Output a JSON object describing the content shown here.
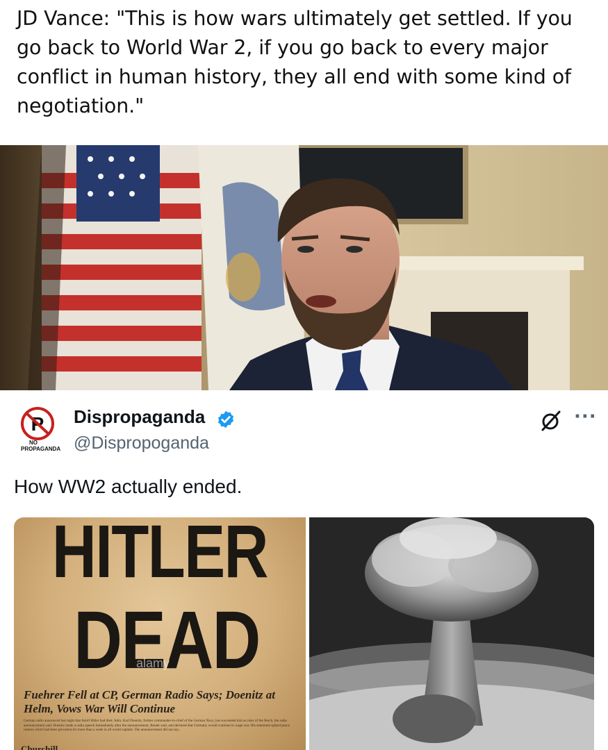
{
  "quote": {
    "text": "JD Vance: \"This is how wars ultimately get settled. If you go back to World War 2, if you go back to every major conflict in human history, they all end with some kind of negotiation.\""
  },
  "tweet": {
    "display_name": "Dispropaganda",
    "handle": "@Dispropoganda",
    "avatar_text_top": "NO",
    "avatar_text_bottom": "PROPAGANDA",
    "text": "How WW2 actually ended.",
    "verified_color": "#1d9bf0",
    "more_label": "···"
  },
  "newspaper": {
    "headline_line1": "HITLER",
    "headline_line2": "DEAD",
    "subhead": "Fuehrer Fell at CP, German Radio Says; Doenitz at Helm, Vows War Will Continue",
    "small_print": "German radio announced last night that Adolf Hitler had died. Adm. Karl Doenitz, former commander-in-chief of the German Navy, has succeeded him as ruler of the Reich, the radio announcement said. Doenitz made a radio speech immediately after the announcement, Reuter said, and declared that Germany would continue to wage war. His statement spiked peace rumors which had been prevalent for more than a week in all world capitals. The announcement did not say...",
    "column_label": "Churchill",
    "watermark": "alamy"
  }
}
